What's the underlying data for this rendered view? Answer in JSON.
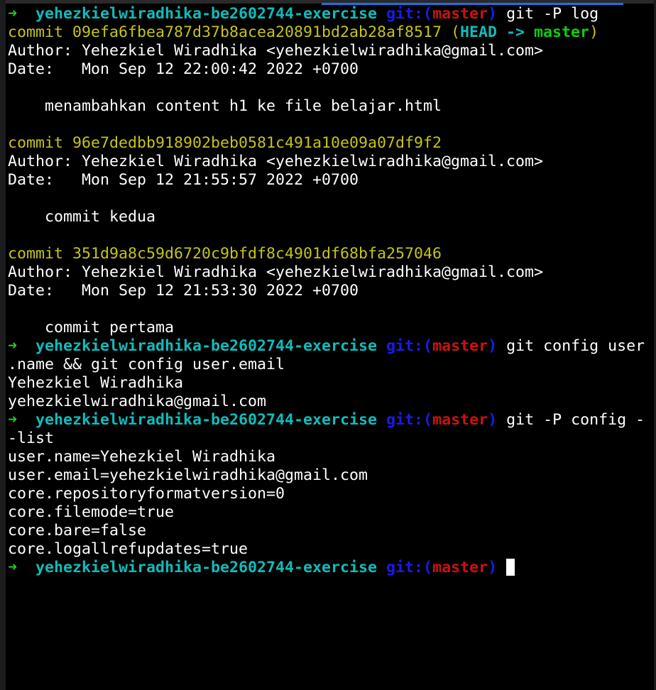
{
  "colors": {
    "arrow": "#22cc22",
    "dir": "#11bbbb",
    "git": "#1a1aee",
    "branch": "#cc1111",
    "hash": "#c4c41a",
    "text": "#ffffff",
    "head": "#11bbbb",
    "master": "#11cc11"
  },
  "lines": [
    [
      {
        "t": "➜  ",
        "c": "arrow",
        "b": 1
      },
      {
        "t": "yehezkielwiradhika-be2602744-exercise",
        "c": "dir",
        "b": 1
      },
      {
        "t": " git:(",
        "c": "git",
        "b": 1
      },
      {
        "t": "master",
        "c": "branch",
        "b": 1
      },
      {
        "t": ")",
        "c": "git",
        "b": 1
      },
      {
        "t": " git -P log",
        "c": "text"
      }
    ],
    [
      {
        "t": "commit 09efa6fbea787d37b8acea20891bd2ab28af8517 (",
        "c": "hash"
      },
      {
        "t": "HEAD -> ",
        "c": "head",
        "b": 1
      },
      {
        "t": "master",
        "c": "master",
        "b": 1
      },
      {
        "t": ")",
        "c": "hash"
      }
    ],
    [
      {
        "t": "Author: Yehezkiel Wiradhika <yehezkielwiradhika@gmail.com>",
        "c": "text"
      }
    ],
    [
      {
        "t": "Date:   Mon Sep 12 22:00:42 2022 +0700",
        "c": "text"
      }
    ],
    [],
    [
      {
        "t": "    menambahkan content h1 ke file belajar.html",
        "c": "text"
      }
    ],
    [],
    [
      {
        "t": "commit 96e7dedbb918902beb0581c491a10e09a07df9f2",
        "c": "hash"
      }
    ],
    [
      {
        "t": "Author: Yehezkiel Wiradhika <yehezkielwiradhika@gmail.com>",
        "c": "text"
      }
    ],
    [
      {
        "t": "Date:   Mon Sep 12 21:55:57 2022 +0700",
        "c": "text"
      }
    ],
    [],
    [
      {
        "t": "    commit kedua",
        "c": "text"
      }
    ],
    [],
    [
      {
        "t": "commit 351d9a8c59d6720c9bfdf8c4901df68bfa257046",
        "c": "hash"
      }
    ],
    [
      {
        "t": "Author: Yehezkiel Wiradhika <yehezkielwiradhika@gmail.com>",
        "c": "text"
      }
    ],
    [
      {
        "t": "Date:   Mon Sep 12 21:53:30 2022 +0700",
        "c": "text"
      }
    ],
    [],
    [
      {
        "t": "    commit pertama",
        "c": "text"
      }
    ],
    [
      {
        "t": "➜  ",
        "c": "arrow",
        "b": 1
      },
      {
        "t": "yehezkielwiradhika-be2602744-exercise",
        "c": "dir",
        "b": 1
      },
      {
        "t": " git:(",
        "c": "git",
        "b": 1
      },
      {
        "t": "master",
        "c": "branch",
        "b": 1
      },
      {
        "t": ")",
        "c": "git",
        "b": 1
      },
      {
        "t": " git config user",
        "c": "text"
      }
    ],
    [
      {
        "t": ".name && git config user.email",
        "c": "text"
      }
    ],
    [
      {
        "t": "Yehezkiel Wiradhika",
        "c": "text"
      }
    ],
    [
      {
        "t": "yehezkielwiradhika@gmail.com",
        "c": "text"
      }
    ],
    [
      {
        "t": "➜  ",
        "c": "arrow",
        "b": 1
      },
      {
        "t": "yehezkielwiradhika-be2602744-exercise",
        "c": "dir",
        "b": 1
      },
      {
        "t": " git:(",
        "c": "git",
        "b": 1
      },
      {
        "t": "master",
        "c": "branch",
        "b": 1
      },
      {
        "t": ")",
        "c": "git",
        "b": 1
      },
      {
        "t": " git -P config -",
        "c": "text"
      }
    ],
    [
      {
        "t": "-list",
        "c": "text"
      }
    ],
    [
      {
        "t": "user.name=Yehezkiel Wiradhika",
        "c": "text"
      }
    ],
    [
      {
        "t": "user.email=yehezkielwiradhika@gmail.com",
        "c": "text"
      }
    ],
    [
      {
        "t": "core.repositoryformatversion=0",
        "c": "text"
      }
    ],
    [
      {
        "t": "core.filemode=true",
        "c": "text"
      }
    ],
    [
      {
        "t": "core.bare=false",
        "c": "text"
      }
    ],
    [
      {
        "t": "core.logallrefupdates=true",
        "c": "text"
      }
    ],
    [
      {
        "t": "➜  ",
        "c": "arrow",
        "b": 1
      },
      {
        "t": "yehezkielwiradhika-be2602744-exercise",
        "c": "dir",
        "b": 1
      },
      {
        "t": " git:(",
        "c": "git",
        "b": 1
      },
      {
        "t": "master",
        "c": "branch",
        "b": 1
      },
      {
        "t": ")",
        "c": "git",
        "b": 1
      },
      {
        "t": " ",
        "c": "text"
      }
    ]
  ]
}
